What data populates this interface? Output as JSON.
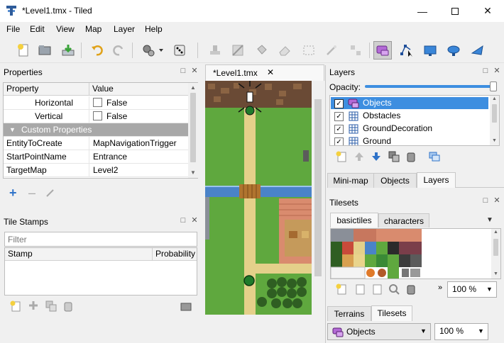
{
  "window": {
    "title": "*Level1.tmx - Tiled"
  },
  "menu": [
    "File",
    "Edit",
    "View",
    "Map",
    "Layer",
    "Help"
  ],
  "properties": {
    "title": "Properties",
    "header": [
      "Property",
      "Value"
    ],
    "rows": [
      {
        "name": "Horizontal",
        "value": "False",
        "checkbox": true
      },
      {
        "name": "Vertical",
        "value": "False",
        "checkbox": true
      },
      {
        "name": "Custom Properties",
        "section": true
      },
      {
        "name": "EntityToCreate",
        "value": "MapNavigationTrigger"
      },
      {
        "name": "StartPointName",
        "value": "Entrance"
      },
      {
        "name": "TargetMap",
        "value": "Level2"
      }
    ]
  },
  "tile_stamps": {
    "title": "Tile Stamps",
    "filter_placeholder": "Filter",
    "header": [
      "Stamp",
      "Probability"
    ]
  },
  "document_tab": "*Level1.tmx",
  "layers": {
    "title": "Layers",
    "opacity_label": "Opacity:",
    "opacity": 1.0,
    "items": [
      {
        "name": "Objects",
        "selected": true
      },
      {
        "name": "Obstacles"
      },
      {
        "name": "GroundDecoration"
      },
      {
        "name": "Ground"
      }
    ],
    "tabs": [
      "Mini-map",
      "Objects",
      "Layers"
    ],
    "active_tab": "Layers"
  },
  "tilesets": {
    "title": "Tilesets",
    "tabs": [
      "basictiles",
      "characters"
    ],
    "zoom": "100 %",
    "bottom_tabs": [
      "Terrains",
      "Tilesets"
    ]
  },
  "status": {
    "layer_combo": "Objects",
    "zoom": "100 %"
  },
  "colors": {
    "selection": "#3d8ee0",
    "grass": "#5fa83e",
    "path": "#e4d08a",
    "water": "#4a83c8",
    "brick": "#d98b6e"
  }
}
